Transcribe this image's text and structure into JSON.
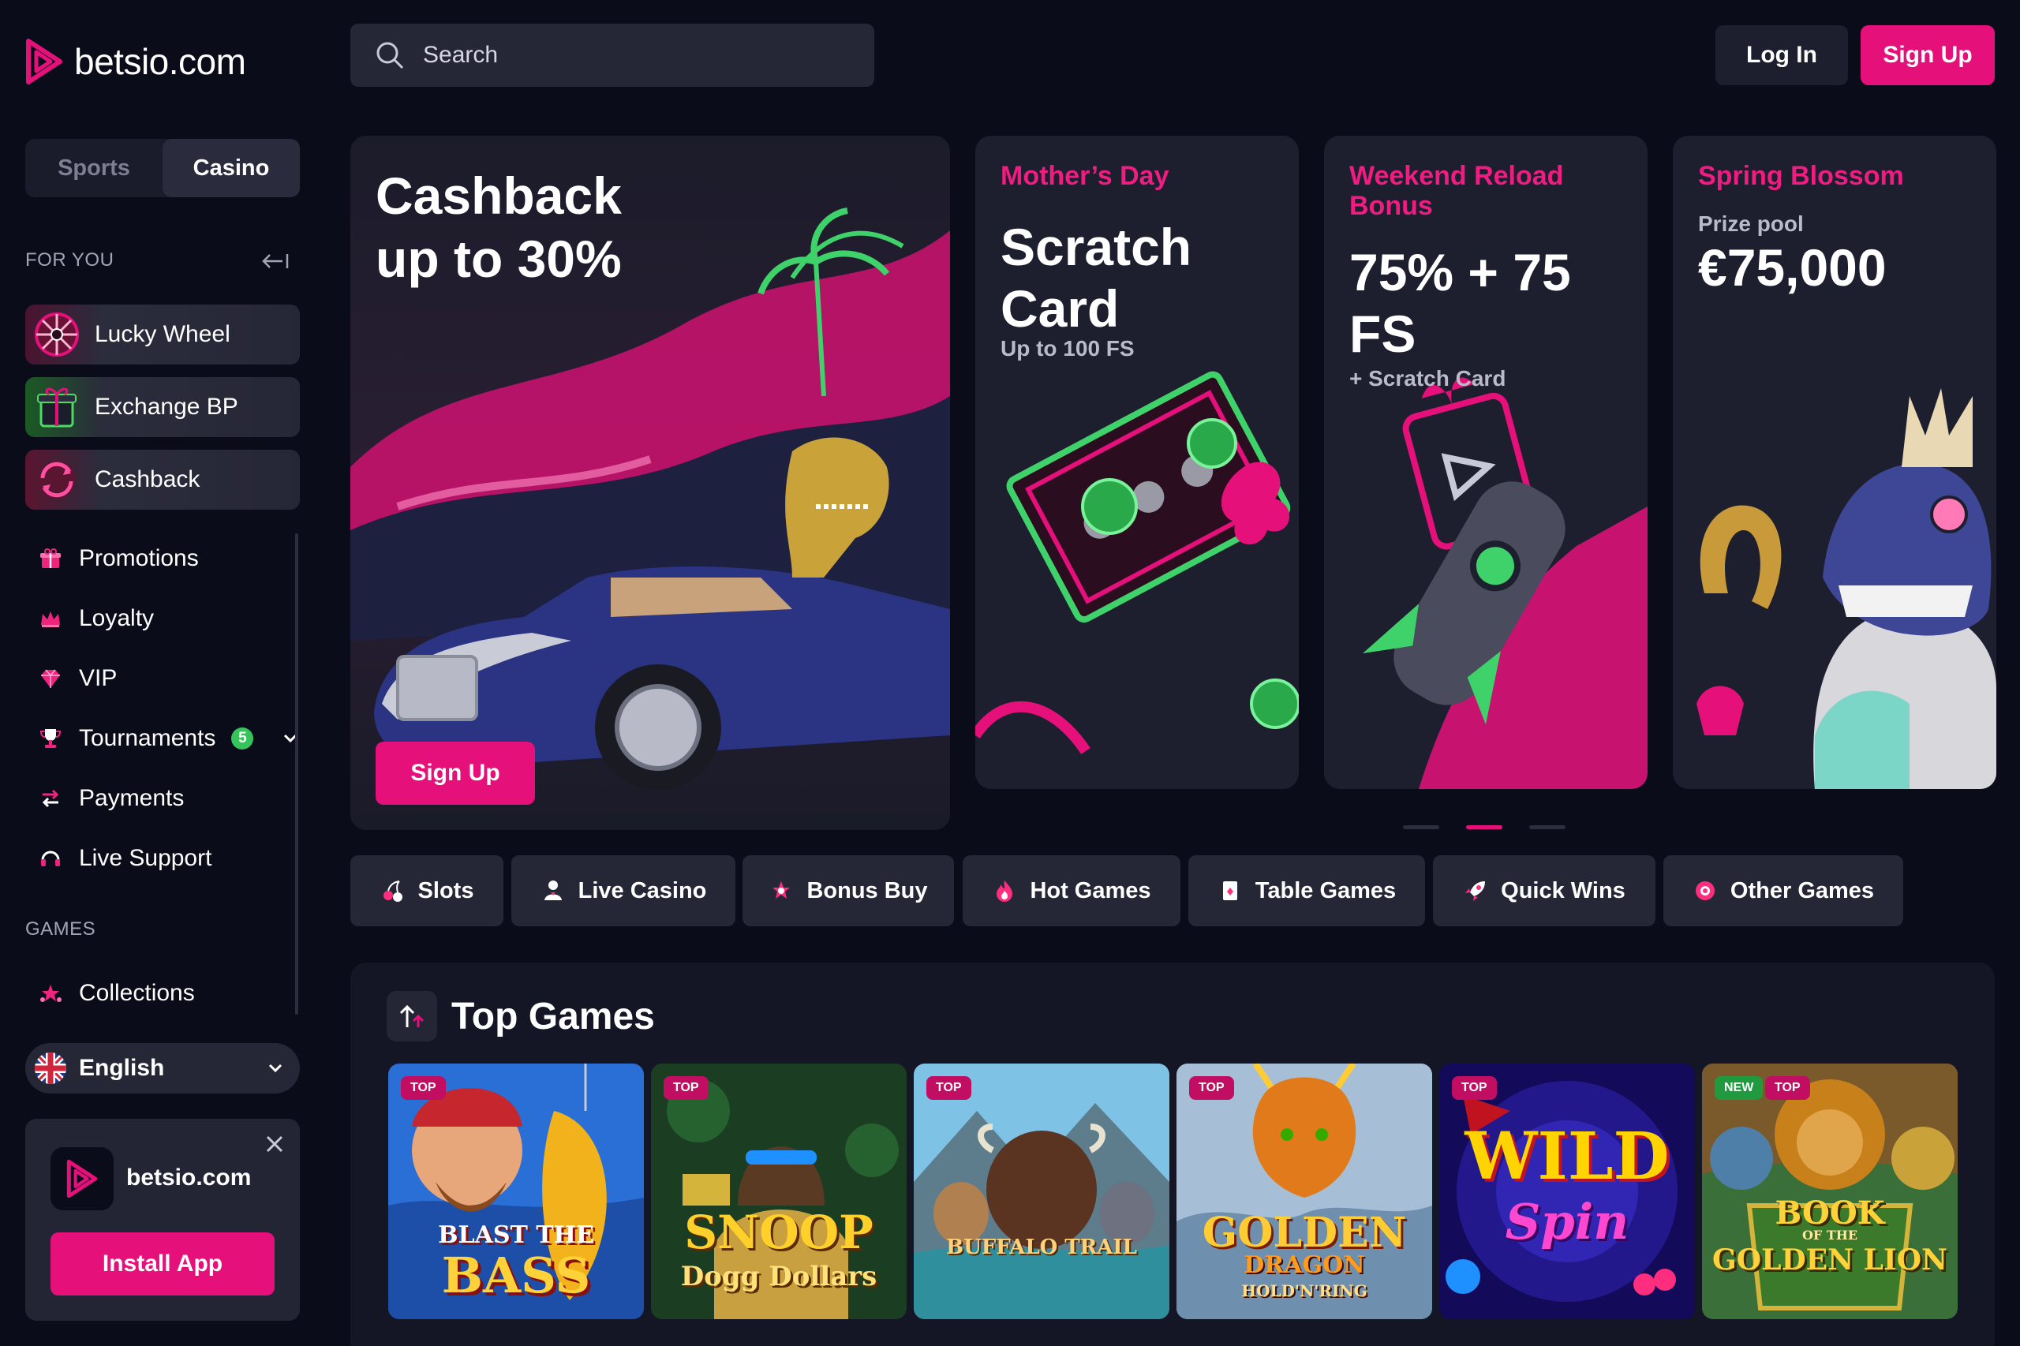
{
  "brand": {
    "name": "betsio.com",
    "accent": "#e5107a"
  },
  "switch": {
    "sports": "Sports",
    "casino": "Casino"
  },
  "for_you": {
    "heading": "FOR YOU",
    "features": [
      {
        "label": "Lucky Wheel",
        "icon": "wheel-icon"
      },
      {
        "label": "Exchange BP",
        "icon": "gift-box-icon"
      },
      {
        "label": "Cashback",
        "icon": "cashback-icon"
      }
    ],
    "nav": [
      {
        "label": "Promotions",
        "icon": "gift-icon"
      },
      {
        "label": "Loyalty",
        "icon": "crown-icon"
      },
      {
        "label": "VIP",
        "icon": "diamond-icon"
      },
      {
        "label": "Tournaments",
        "icon": "trophy-icon",
        "badge": "5"
      },
      {
        "label": "Payments",
        "icon": "transfer-icon"
      },
      {
        "label": "Live Support",
        "icon": "headset-icon"
      }
    ]
  },
  "games_section": {
    "heading": "GAMES",
    "collections": "Collections"
  },
  "language": {
    "label": "English"
  },
  "app_card": {
    "name": "betsio.com",
    "button": "Install App"
  },
  "header": {
    "search_placeholder": "Search",
    "login": "Log In",
    "signup": "Sign Up"
  },
  "banners": {
    "main": {
      "line1": "Cashback",
      "line2": "up to 30%",
      "cta": "Sign Up"
    },
    "promos": [
      {
        "kicker": "Mother’s Day",
        "big1": "Scratch",
        "big2": "Card",
        "small": "Up to 100 FS"
      },
      {
        "kicker": "Weekend Reload Bonus",
        "big1": "75% + 75",
        "big2": "FS",
        "small": "+ Scratch Card"
      },
      {
        "kicker": "Spring Blossom",
        "small": "Prize pool",
        "big1": "€75,000"
      }
    ],
    "active_slide": 2,
    "slide_count": 3
  },
  "categories": [
    {
      "label": "Slots",
      "icon": "cherry-icon"
    },
    {
      "label": "Live Casino",
      "icon": "dealer-icon"
    },
    {
      "label": "Bonus Buy",
      "icon": "bonus-icon"
    },
    {
      "label": "Hot Games",
      "icon": "flame-icon"
    },
    {
      "label": "Table Games",
      "icon": "card-icon"
    },
    {
      "label": "Quick Wins",
      "icon": "rocket-icon"
    },
    {
      "label": "Other Games",
      "icon": "chip-icon"
    }
  ],
  "top_games": {
    "title": "Top Games",
    "games": [
      {
        "title": "Blast the Bass",
        "line1": "BLAST THE",
        "line2": "BASS",
        "tags": [
          "TOP"
        ]
      },
      {
        "title": "Snoop Dogg Dollars",
        "line1": "SNOOP",
        "line2": "Dogg Dollars",
        "tags": [
          "TOP"
        ]
      },
      {
        "title": "Buffalo Trail",
        "line1": "BUFFALO TRAIL",
        "line2": "",
        "tags": [
          "TOP"
        ]
      },
      {
        "title": "Golden Dragon Hold 'n' Ring",
        "line1": "GOLDEN",
        "line2": "DRAGON",
        "line3": "HOLD'N'RING",
        "tags": [
          "TOP"
        ]
      },
      {
        "title": "Wild Spin",
        "line1": "WILD",
        "line2": "Spin",
        "tags": [
          "TOP"
        ]
      },
      {
        "title": "Book of the Golden Lion",
        "line1": "BOOK",
        "line2": "OF THE",
        "line3": "GOLDEN LION",
        "tags": [
          "NEW",
          "TOP"
        ]
      }
    ]
  }
}
